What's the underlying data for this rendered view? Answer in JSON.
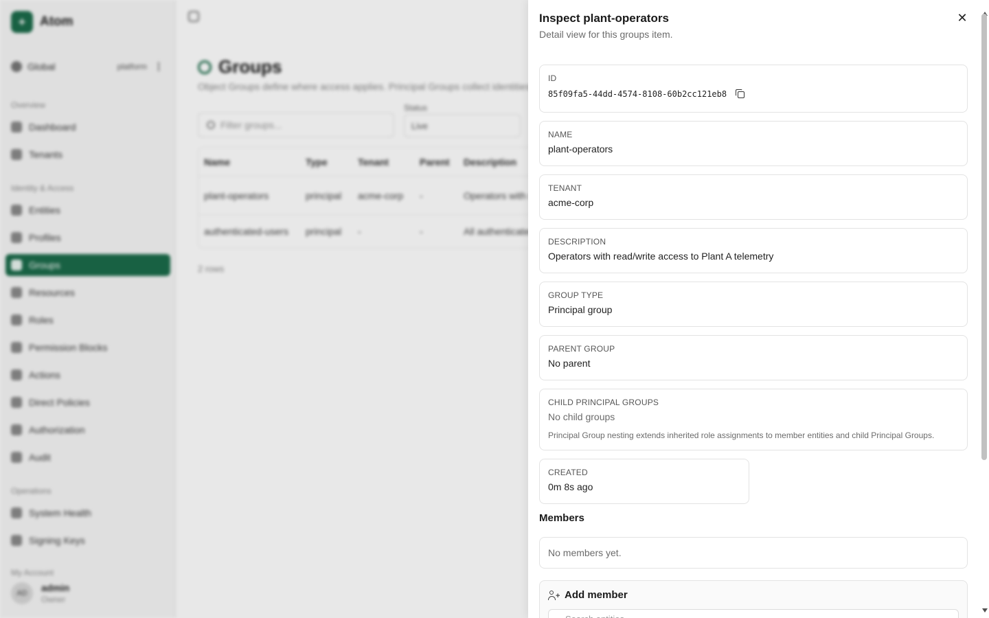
{
  "app": {
    "brand": "Atom",
    "scope": {
      "label": "Global",
      "badge": "platform"
    },
    "sections": {
      "overview": "Overview",
      "identity": "Identity & Access",
      "operations": "Operations",
      "account": "My Account"
    },
    "nav": {
      "dashboard": "Dashboard",
      "tenants": "Tenants",
      "entities": "Entities",
      "profiles": "Profiles",
      "groups": "Groups",
      "resources": "Resources",
      "roles": "Roles",
      "permission_blocks": "Permission Blocks",
      "actions": "Actions",
      "direct_policies": "Direct Policies",
      "authorization": "Authorization",
      "audit": "Audit",
      "system_health": "System Health",
      "signing_keys": "Signing Keys"
    },
    "user": {
      "initials": "AD",
      "name": "admin",
      "role": "Owner"
    }
  },
  "page": {
    "title": "Groups",
    "subtitle": "Object Groups define where access applies. Principal Groups collect identities.",
    "filter_placeholder": "Filter groups...",
    "status_label": "Status",
    "status_value": "Live",
    "columns": [
      "Name",
      "Type",
      "Tenant",
      "Parent",
      "Description"
    ],
    "rows": [
      [
        "plant-operators",
        "principal",
        "acme-corp",
        "-",
        "Operators with read/write access to Plant A telemetry"
      ],
      [
        "authenticated-users",
        "principal",
        "-",
        "-",
        "All authenticated users"
      ]
    ],
    "count": "2 rows"
  },
  "drawer": {
    "title": "Inspect plant-operators",
    "subtitle": "Detail view for this groups item.",
    "close_glyph": "✕",
    "id": {
      "label": "ID",
      "value": "85f09fa5-44dd-4574-8108-60b2cc121eb8"
    },
    "name": {
      "label": "NAME",
      "value": "plant-operators"
    },
    "tenant": {
      "label": "TENANT",
      "value": "acme-corp"
    },
    "description": {
      "label": "DESCRIPTION",
      "value": "Operators with read/write access to Plant A telemetry"
    },
    "group_type": {
      "label": "GROUP TYPE",
      "value": "Principal group"
    },
    "parent_group": {
      "label": "PARENT GROUP",
      "value": "No parent"
    },
    "child_groups": {
      "label": "CHILD PRINCIPAL GROUPS",
      "value": "No child groups",
      "note": "Principal Group nesting extends inherited role assignments to member entities and child Principal Groups."
    },
    "created": {
      "label": "CREATED",
      "value": "0m 8s ago"
    },
    "members": {
      "heading": "Members",
      "empty": "No members yet."
    },
    "add_member": {
      "title": "Add member",
      "input_placeholder": "Search entities..."
    }
  },
  "icons": {
    "close": "close-icon",
    "copy": "copy-icon",
    "add_member": "user-plus-icon"
  },
  "colors": {
    "accent": "#1b6b4a"
  }
}
